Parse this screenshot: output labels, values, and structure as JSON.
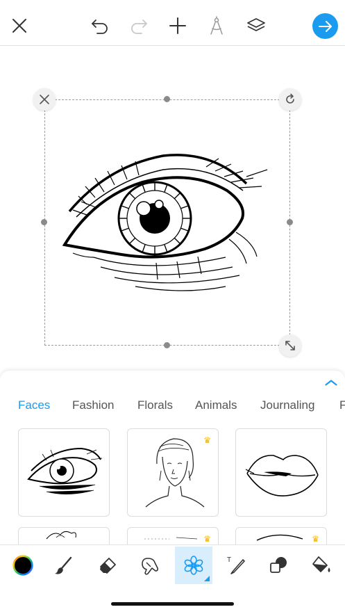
{
  "top_toolbar": {
    "close_icon": "close-icon",
    "undo_icon": "undo-icon",
    "redo_icon": "redo-icon",
    "add_icon": "plus-icon",
    "compass_icon": "compass-icon",
    "layers_icon": "layers-icon",
    "next_icon": "arrow-right-icon"
  },
  "colors": {
    "accent": "#1a9bf0",
    "selected_tool_bg": "#d9eefc",
    "premium_crown": "#f5b400"
  },
  "sheet": {
    "tabs": [
      {
        "label": "Faces",
        "active": true
      },
      {
        "label": "Fashion",
        "active": false
      },
      {
        "label": "Florals",
        "active": false
      },
      {
        "label": "Animals",
        "active": false
      },
      {
        "label": "Journaling",
        "active": false
      },
      {
        "label": "F",
        "active": false
      }
    ],
    "stickers": [
      {
        "name": "eye-sticker",
        "premium": false
      },
      {
        "name": "woman-portrait-sticker",
        "premium": true
      },
      {
        "name": "lips-sticker",
        "premium": false
      },
      {
        "name": "hair-sticker",
        "premium": false
      },
      {
        "name": "sticker-5",
        "premium": true
      },
      {
        "name": "sticker-6",
        "premium": true
      }
    ]
  },
  "bottom_toolbar": {
    "tools": [
      "color-picker",
      "brush",
      "eraser",
      "smudge",
      "sticker",
      "text",
      "shape",
      "fill"
    ],
    "selected_tool": "sticker"
  }
}
